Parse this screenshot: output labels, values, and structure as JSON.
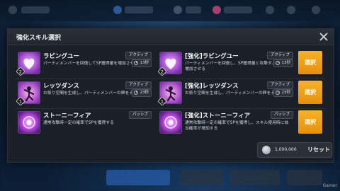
{
  "modal": {
    "title": "強化スキル選択",
    "skills": [
      {
        "name": "ラビングユー",
        "desc": "パーティメンバーを回復してSP獲得量を増加させる。",
        "type": "アクティブ",
        "cooldown": "13秒",
        "level": "2",
        "icon": "heart-kiss-icon"
      },
      {
        "name": "[強化]ラビングユー",
        "desc": "パーティメンバーを回復し、SP獲得量と攻撃ダメージを増加させる",
        "type": "アクティブ",
        "cooldown": "13秒",
        "level": "2",
        "icon": "heart-kiss-icon"
      },
      {
        "name": "レッツダンス",
        "desc": "お祭り空間を生成し、パーティメンバーの興をそそる",
        "type": "アクティブ",
        "cooldown": "23秒",
        "level": "1",
        "icon": "dance-icon"
      },
      {
        "name": "[強化]レッツダンス",
        "desc": "お祭り空間を生成し、パーティメンバーの興をそそる",
        "type": "アクティブ",
        "cooldown": "23秒",
        "level": "1",
        "icon": "dance-icon"
      },
      {
        "name": "ストーニーフィア",
        "desc": "通常攻撃時一定の確率でSPを獲得する",
        "type": "パッシブ",
        "icon": "stony-fear-icon"
      },
      {
        "name": "[強化]ストーニーフィア",
        "desc": "通常攻撃時一定の確率でSPを獲得し、スキル使用時に該当確率が増加する",
        "type": "パッシブ",
        "icon": "stony-fear-icon"
      }
    ],
    "select_label": "選択",
    "reset": {
      "cost": "1,000,000",
      "label": "リセット"
    }
  },
  "watermark": "Gamer",
  "colors": {
    "accent": "#f0a11c",
    "modal_bg": "#1b1f27",
    "icon_purple": "#9b3fd0"
  }
}
